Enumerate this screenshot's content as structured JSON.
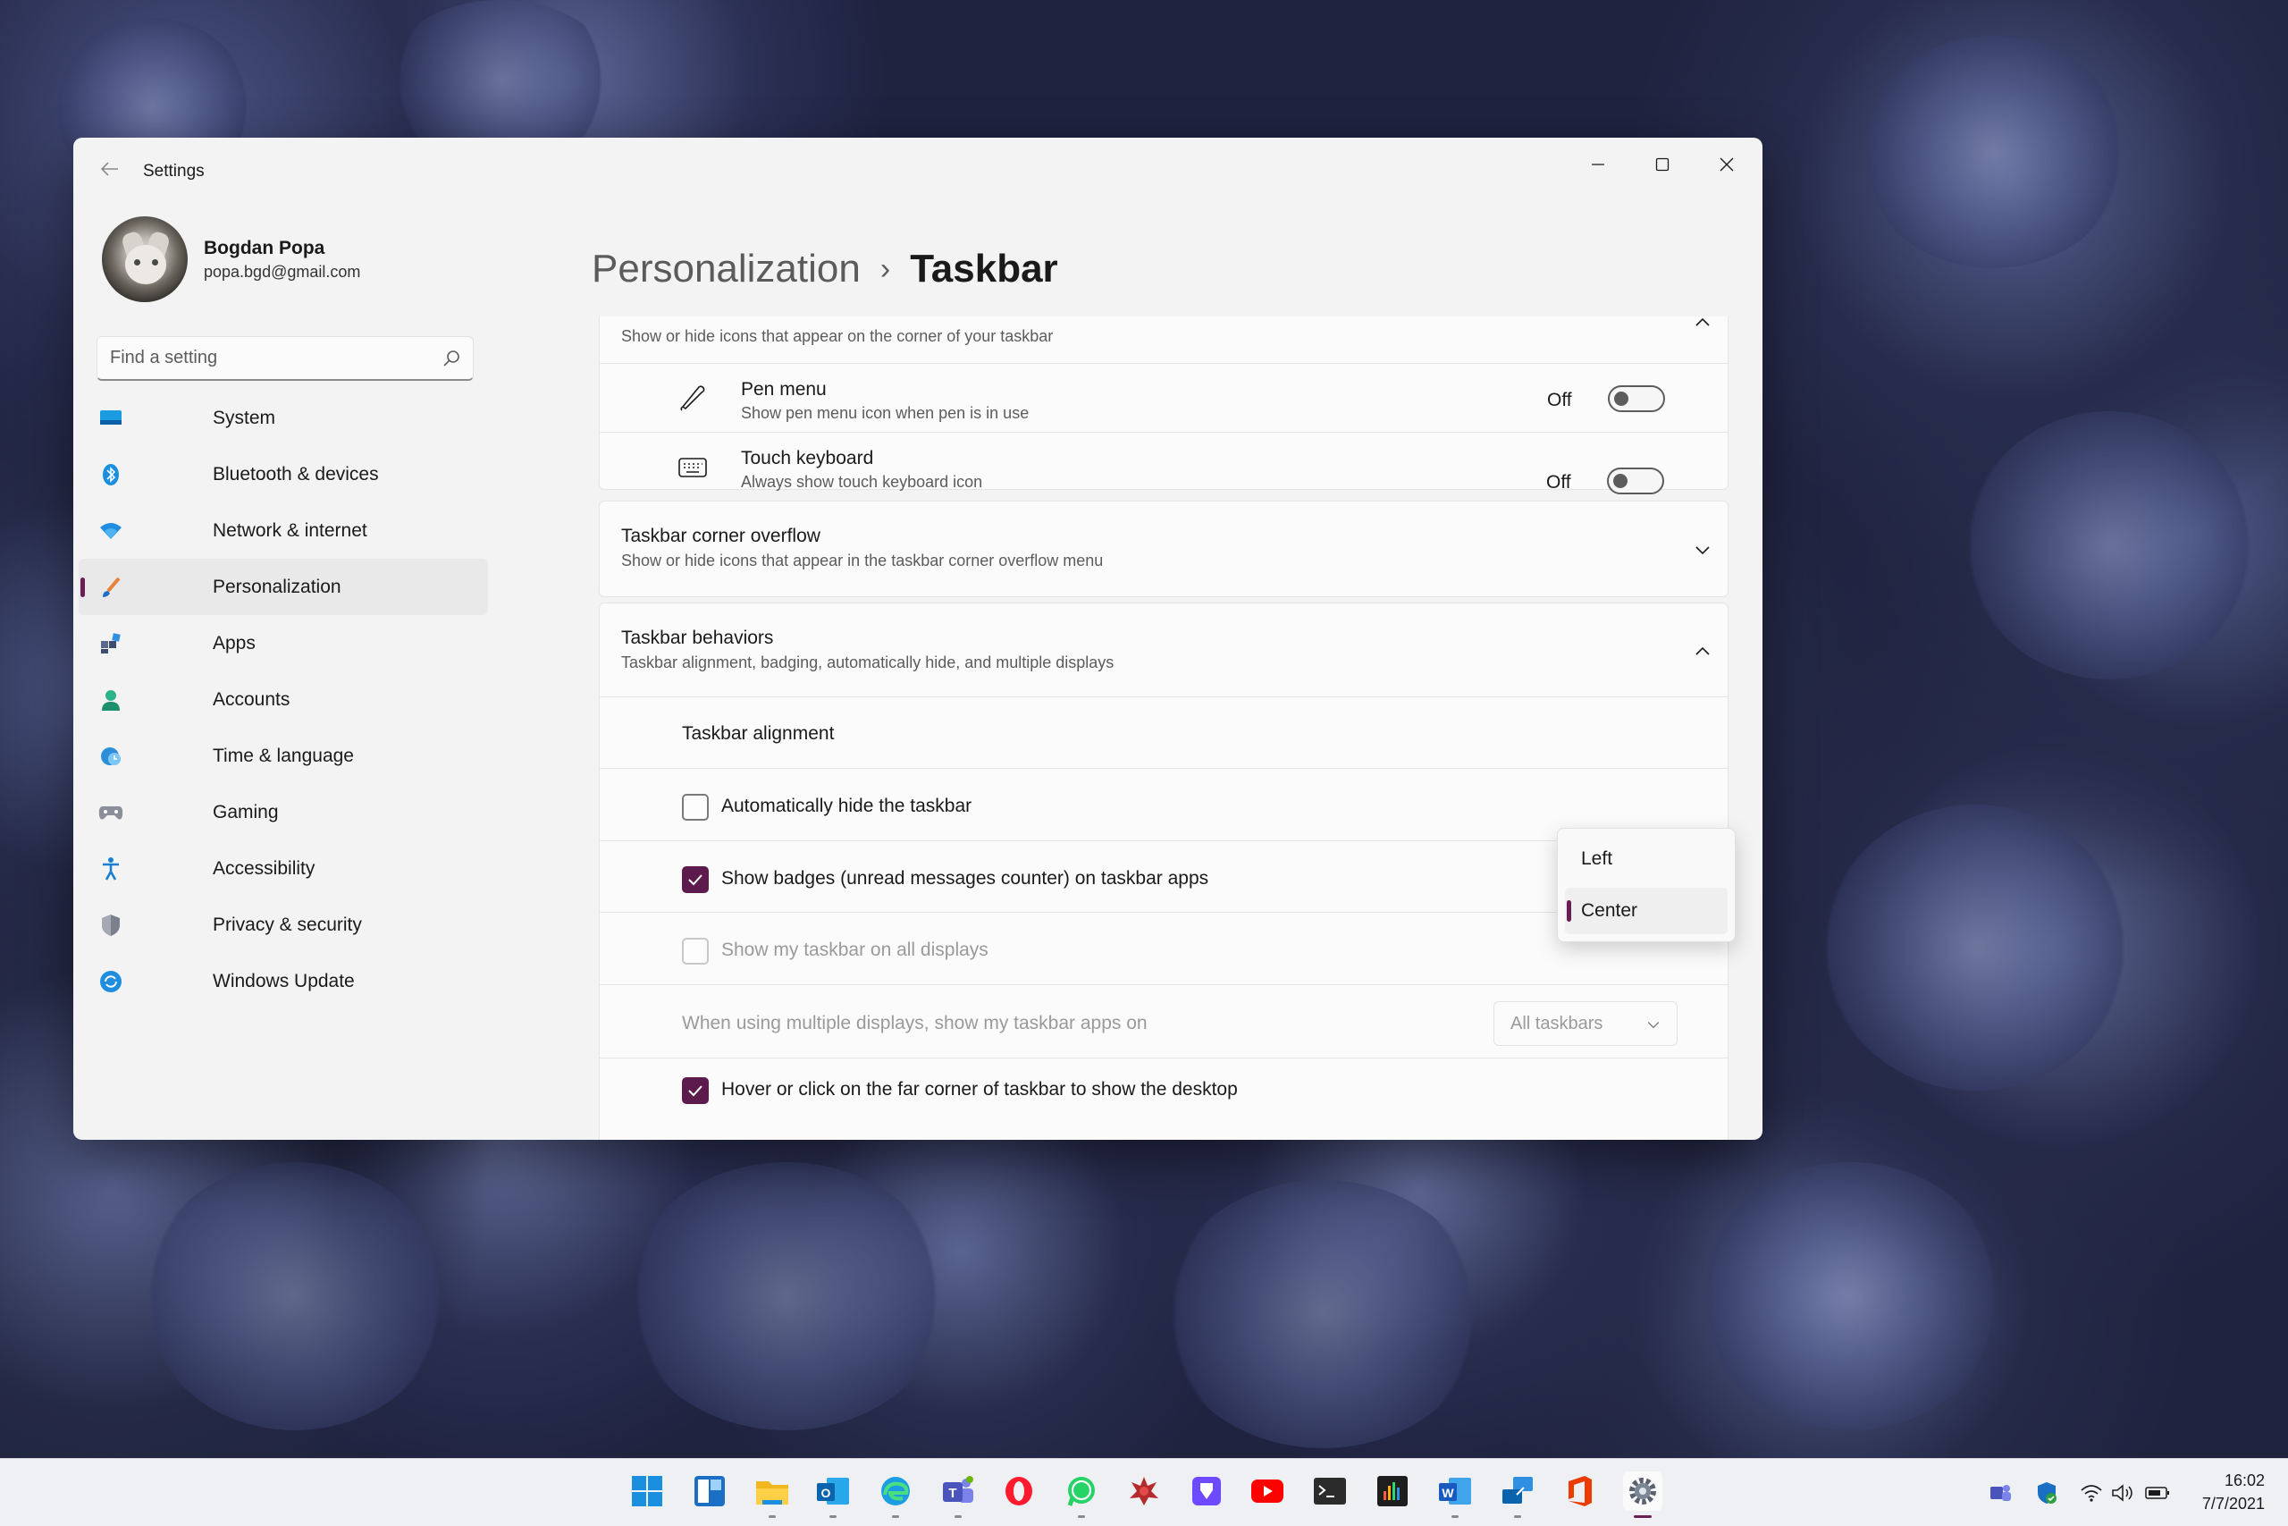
{
  "window": {
    "title": "Settings"
  },
  "profile": {
    "name": "Bogdan Popa",
    "email": "popa.bgd@gmail.com"
  },
  "search": {
    "placeholder": "Find a setting"
  },
  "sidebar": {
    "items": [
      {
        "label": "System",
        "icon": "system-icon"
      },
      {
        "label": "Bluetooth & devices",
        "icon": "bluetooth-icon"
      },
      {
        "label": "Network & internet",
        "icon": "wifi-icon"
      },
      {
        "label": "Personalization",
        "icon": "brush-icon",
        "active": true
      },
      {
        "label": "Apps",
        "icon": "apps-icon"
      },
      {
        "label": "Accounts",
        "icon": "person-icon"
      },
      {
        "label": "Time & language",
        "icon": "globe-clock-icon"
      },
      {
        "label": "Gaming",
        "icon": "gamepad-icon"
      },
      {
        "label": "Accessibility",
        "icon": "accessibility-icon"
      },
      {
        "label": "Privacy & security",
        "icon": "shield-icon"
      },
      {
        "label": "Windows Update",
        "icon": "update-icon"
      }
    ]
  },
  "breadcrumb": {
    "parent": "Personalization",
    "separator": "›",
    "current": "Taskbar"
  },
  "corner_icons": {
    "subtitle": "Show or hide icons that appear on the corner of your taskbar",
    "pen_menu": {
      "title": "Pen menu",
      "subtitle": "Show pen menu icon when pen is in use",
      "state": "Off"
    },
    "touch_keyboard": {
      "title": "Touch keyboard",
      "subtitle": "Always show touch keyboard icon",
      "state": "Off"
    }
  },
  "corner_overflow": {
    "title": "Taskbar corner overflow",
    "subtitle": "Show or hide icons that appear in the taskbar corner overflow menu"
  },
  "behaviors": {
    "title": "Taskbar behaviors",
    "subtitle": "Taskbar alignment, badging, automatically hide, and multiple displays",
    "alignment_label": "Taskbar alignment",
    "alignment_options": [
      "Left",
      "Center"
    ],
    "alignment_selected": "Center",
    "auto_hide": {
      "label": "Automatically hide the taskbar",
      "checked": false
    },
    "badges": {
      "label": "Show badges (unread messages counter) on taskbar apps",
      "checked": true
    },
    "all_displays": {
      "label": "Show my taskbar on all displays",
      "checked": false,
      "disabled": true
    },
    "multi_display": {
      "label": "When using multiple displays, show my taskbar apps on",
      "value": "All taskbars"
    },
    "far_corner": {
      "label": "Hover or click on the far corner of taskbar to show the desktop",
      "checked": true
    }
  },
  "taskbar": {
    "apps": [
      "windows-start-icon",
      "widgets-icon",
      "file-explorer-icon",
      "outlook-icon",
      "edge-icon",
      "teams-icon",
      "opera-icon",
      "whatsapp-icon",
      "game-icon",
      "proton-vpn-icon",
      "youtube-icon",
      "terminal-icon",
      "audio-app-icon",
      "word-icon",
      "remote-desktop-icon",
      "office-icon",
      "settings-icon"
    ],
    "clock": {
      "time": "16:02",
      "date": "7/7/2021"
    }
  },
  "colors": {
    "accent": "#5d1a4d",
    "window_bg": "#f3f3f3",
    "card_bg": "#fbfbfb"
  }
}
